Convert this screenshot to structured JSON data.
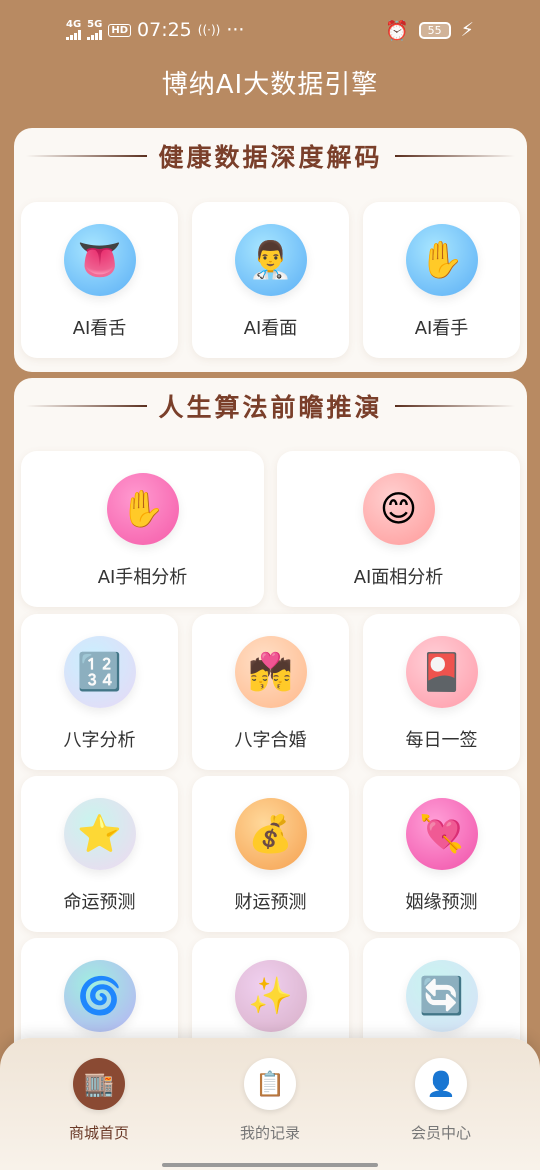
{
  "status": {
    "net1": "4G",
    "net2": "5G",
    "hd": "HD",
    "time": "07:25",
    "battery": "55"
  },
  "app": {
    "title": "博纳AI大数据引擎"
  },
  "section1": {
    "title": "健康数据深度解码",
    "items": [
      {
        "label": "AI看舌",
        "icon": "tongue-icon",
        "glyph": "👅"
      },
      {
        "label": "AI看面",
        "icon": "doctor-icon",
        "glyph": "👨‍⚕️"
      },
      {
        "label": "AI看手",
        "icon": "hand-icon",
        "glyph": "✋"
      }
    ]
  },
  "section2": {
    "title": "人生算法前瞻推演",
    "items": [
      {
        "label": "AI手相分析",
        "icon": "palm-icon",
        "glyph": "✋"
      },
      {
        "label": "AI面相分析",
        "icon": "smile-icon",
        "glyph": "😊"
      },
      {
        "label": "八字分析",
        "icon": "numbers-icon",
        "glyph": "🔢"
      },
      {
        "label": "八字合婚",
        "icon": "couple-icon",
        "glyph": "💏"
      },
      {
        "label": "每日一签",
        "icon": "card-icon",
        "glyph": "🎴"
      },
      {
        "label": "命运预测",
        "icon": "star-icon",
        "glyph": "⭐"
      },
      {
        "label": "财运预测",
        "icon": "money-bag-icon",
        "glyph": "💰"
      },
      {
        "label": "姻缘预测",
        "icon": "heart-arrow-icon",
        "glyph": "💘"
      },
      {
        "label": "",
        "icon": "cyclone-icon",
        "glyph": "🌀"
      },
      {
        "label": "",
        "icon": "sparkles-icon",
        "glyph": "✨"
      },
      {
        "label": "",
        "icon": "repeat-icon",
        "glyph": "🔄"
      }
    ]
  },
  "nav": {
    "items": [
      {
        "label": "商城首页",
        "icon": "store-icon",
        "glyph": "🏬"
      },
      {
        "label": "我的记录",
        "icon": "clipboard-icon",
        "glyph": "📋"
      },
      {
        "label": "会员中心",
        "icon": "user-icon",
        "glyph": "👤"
      }
    ]
  },
  "colors": {
    "background": "#b88a62",
    "accent": "#7a3f2a",
    "card": "#fbf8f4"
  }
}
